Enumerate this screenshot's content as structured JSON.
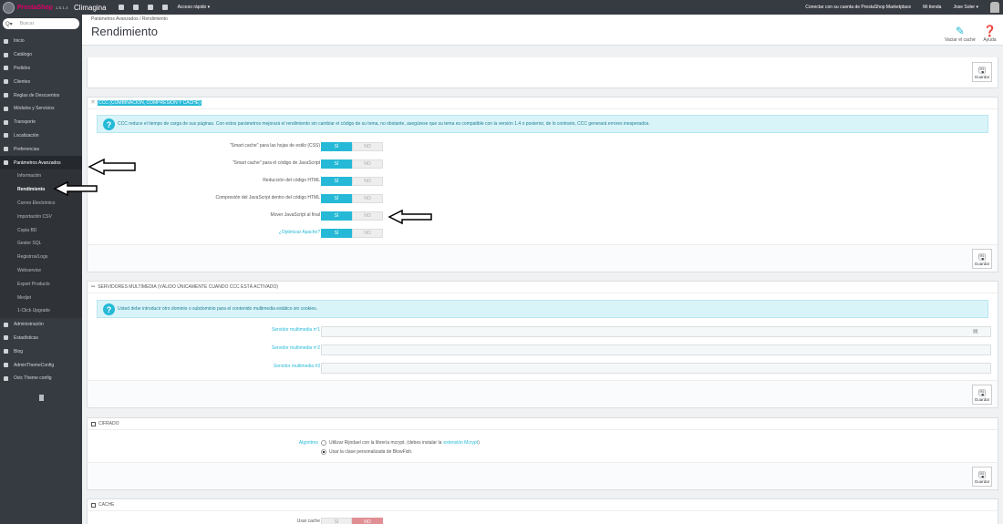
{
  "topbar": {
    "logo_name": "PrestaShop",
    "logo_version": "1.6.1.4",
    "shop_name": "Climagina",
    "quick_access": "Acceso rápido ▾",
    "marketplace": "Conectar con su cuenta de PrestaShop Marketplace",
    "my_shop": "Mi tienda",
    "user": "Jose Soler ▾"
  },
  "sidebar": {
    "search_placeholder": "Buscar",
    "items": [
      {
        "label": "Inicio"
      },
      {
        "label": "Catálogo"
      },
      {
        "label": "Pedidos"
      },
      {
        "label": "Clientes"
      },
      {
        "label": "Reglas de Descuentos"
      },
      {
        "label": "Módulos y Servicios"
      },
      {
        "label": "Transporte"
      },
      {
        "label": "Localización"
      },
      {
        "label": "Preferencias"
      },
      {
        "label": "Parámetros Avanzados"
      }
    ],
    "sub_items": [
      {
        "label": "Información"
      },
      {
        "label": "Rendimiento"
      },
      {
        "label": "Correo Electrónico"
      },
      {
        "label": "Importación CSV"
      },
      {
        "label": "Copia BD"
      },
      {
        "label": "Gestor SQL"
      },
      {
        "label": "Registros/Logs"
      },
      {
        "label": "Webservice"
      },
      {
        "label": "Export Products"
      },
      {
        "label": "Medjet"
      },
      {
        "label": "1-Click Upgrade"
      }
    ],
    "items_after": [
      {
        "label": "Administración"
      },
      {
        "label": "Estadísticas"
      },
      {
        "label": "Blog"
      },
      {
        "label": "AdminThemeConfig"
      },
      {
        "label": "Ovic Theme config"
      }
    ]
  },
  "header": {
    "breadcrumb": "Parámetros Avanzados  /  Rendimiento",
    "title": "Rendimiento",
    "clear_cache": "Vaciar el caché",
    "help": "Ayuda"
  },
  "save_label": "Guardar",
  "ccc": {
    "heading": "CCC (COMBINACIÓN, COMPRESIÓN Y CACHÉ)",
    "alert": "CCC reduce el tiempo de carga de sus páginas. Con estos parámetros mejorará el rendimiento sin cambiar el código de su tema, no obstante, asegúrese que su tema es compatible con la versión 1.4 o posterior, de lo contrario, CCC generará errores inesperados.",
    "yes": "SÍ",
    "no": "NO",
    "rows": [
      {
        "label": "\"Smart cache\" para las hojas de estilo (CSS)"
      },
      {
        "label": "\"Smart cache\" para el código de JavaScript"
      },
      {
        "label": "Reducción del código HTML"
      },
      {
        "label": "Compresión del JavaScript dentro del código HTML"
      },
      {
        "label": "Mover JavaScript al final"
      },
      {
        "label": "¿Optimizar Apache?"
      }
    ]
  },
  "media": {
    "heading": "SERVIDORES MULTIMEDIA (VÁLIDO ÚNICAMENTE CUANDO CCC ESTÁ ACTIVADO)",
    "alert": "Usted debe introducir otro dominio o subdominio para el contenido multimedia estático sin cookies.",
    "fields": [
      {
        "label": "Servidor multimedia nº1",
        "value": ""
      },
      {
        "label": "Servidor multimedia nº2",
        "value": ""
      },
      {
        "label": "Servidor multimedia #3",
        "value": ""
      }
    ]
  },
  "cipher": {
    "heading": "CIFRADO",
    "label": "Algoritmo",
    "option1": "Utilizar Rijndael con la librería mcrypt. (debes instalar la",
    "option1_link": "extensión Mcrypt",
    "option1_end": ")",
    "option2": "Usar la clase personalizada de BlowFish."
  },
  "cache": {
    "heading": "CACHE",
    "label": "Usar cache",
    "yes": "SÍ",
    "no": "NO"
  }
}
